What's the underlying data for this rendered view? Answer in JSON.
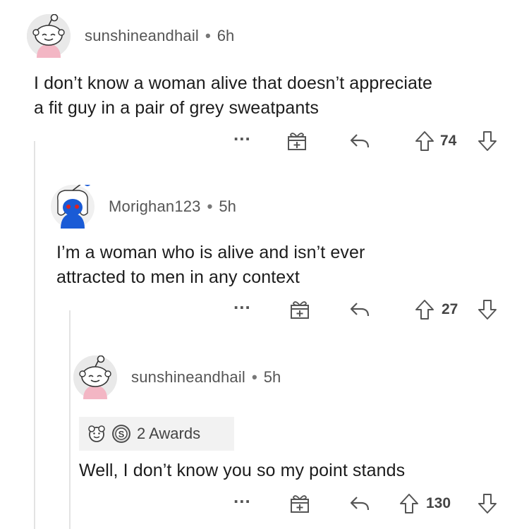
{
  "comments": [
    {
      "username": "sunshineandhail",
      "separator": "•",
      "time": "6h",
      "body_lines": [
        "I don’t know a woman alive that doesn’t appreciate",
        "a fit guy in a pair of grey sweatpants"
      ],
      "more_label": "...",
      "vote_count": "74",
      "avatar": "snoo-avatar-smiling"
    },
    {
      "username": "Morighan123",
      "separator": "•",
      "time": "5h",
      "body_lines": [
        "I’m a woman who is alive and isn’t ever",
        "attracted to men in any context"
      ],
      "more_label": "...",
      "vote_count": "27",
      "avatar": "snoo-avatar-blue"
    },
    {
      "username": "sunshineandhail",
      "separator": "•",
      "time": "5h",
      "awards_label": "2 Awards",
      "body_lines": [
        "Well, I don’t know you so my point stands"
      ],
      "more_label": "...",
      "vote_count": "130",
      "avatar": "snoo-avatar-smiling"
    }
  ],
  "icons": {
    "gift": "gift-icon",
    "reply": "reply-arrow-icon",
    "upvote": "upvote-arrow-icon",
    "downvote": "downvote-arrow-icon",
    "award_silver": "silver-award-icon",
    "award_wholesome": "wholesome-award-icon"
  },
  "colors": {
    "text": "#1c1c1c",
    "meta": "#555555",
    "thread_line": "#e3e3e3",
    "avatar_bg": "#e9e9e9",
    "blue_avatar": "#1a5bd6",
    "awards_bg": "#f2f2f2"
  }
}
